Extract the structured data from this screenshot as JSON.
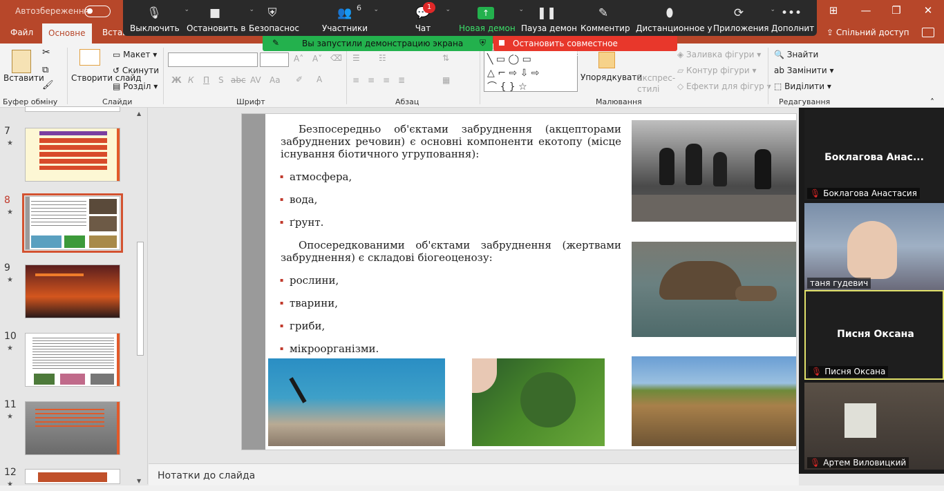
{
  "titlebar": {
    "autosave_label": "Автозбереження",
    "window_controls": [
      "⊞",
      "—",
      "❐",
      "✕"
    ]
  },
  "tabs": [
    "Файл",
    "Основне",
    "Вставл"
  ],
  "share_label": "Спільний доступ",
  "ribbon": {
    "paste_label": "Вставити",
    "new_slide_label": "Створити слайд",
    "layout_label": "Макет",
    "reset_label": "Скинути",
    "section_label": "Розділ",
    "group_clipboard": "Буфер обміну",
    "group_slides": "Слайди",
    "group_font": "Шрифт",
    "group_paragraph": "Абзац",
    "group_drawing": "Малювання",
    "group_editing": "Редагування",
    "arrange_label": "Упорядкувати",
    "quick_styles_label": "Експрес-стилі",
    "shape_fill": "Заливка фігури",
    "shape_outline": "Контур фігури",
    "shape_effects": "Ефекти для фігур",
    "find_label": "Знайти",
    "replace_label": "Замінити",
    "select_label": "Виділити",
    "font_buttons": [
      "Ж",
      "К",
      "П",
      "S",
      "abc",
      "AV",
      "Aa"
    ]
  },
  "zoom": {
    "buttons": [
      {
        "label": "Выключить",
        "icon": "microphone-icon",
        "glyph": "🎙"
      },
      {
        "label": "Остановить в",
        "icon": "video-camera-icon",
        "glyph": "■"
      },
      {
        "label": "Безопаснос",
        "icon": "shield-icon",
        "glyph": "⛨"
      },
      {
        "label": "Участники",
        "icon": "participants-icon",
        "glyph": "👥"
      },
      {
        "label": "Чат",
        "icon": "chat-icon",
        "glyph": "💬"
      },
      {
        "label": "Новая демон",
        "icon": "share-screen-icon",
        "glyph": "↑"
      },
      {
        "label": "Пауза демон",
        "icon": "pause-icon",
        "glyph": "❚❚"
      },
      {
        "label": "Комментир",
        "icon": "annotate-icon",
        "glyph": "✎"
      },
      {
        "label": "Дистанционное у",
        "icon": "remote-control-icon",
        "glyph": "⬮"
      },
      {
        "label": "Приложения",
        "icon": "apps-icon",
        "glyph": "⟳"
      },
      {
        "label": "Дополнит",
        "icon": "more-icon",
        "glyph": "•••"
      }
    ],
    "participant_count": "6",
    "chat_badge": "1",
    "share_banner": "Вы запустили демонстрацию экрана",
    "stop_banner": "Остановить совместное использование"
  },
  "thumbnails": [
    {
      "num": "7",
      "star": "★"
    },
    {
      "num": "8",
      "star": "★"
    },
    {
      "num": "9",
      "star": "★"
    },
    {
      "num": "10",
      "star": "★"
    },
    {
      "num": "11",
      "star": "★"
    },
    {
      "num": "12",
      "star": "★"
    }
  ],
  "slide": {
    "paragraph1": "Безпосередньо об'єктами забруднення (акцепторами забруднених речовин) є основні компоненти екотопу (місце існування біотичного угруповання):",
    "bullets1": [
      "атмосфера,",
      "вода,",
      "ґрунт."
    ],
    "paragraph2": "Опосередкованими об'єктами забруднення (жертвами забруднення) є складові біогеоценозу:",
    "bullets2": [
      "рослини,",
      "тварини,",
      "гриби,",
      "мікроорганізми."
    ]
  },
  "notes_placeholder": "Нотатки до слайда",
  "video_tiles": [
    {
      "big_name": "Боклагова  Анас...",
      "label": "Боклагова Анастасия",
      "muted": true
    },
    {
      "big_name": "",
      "label": "таня гудевич",
      "muted": false
    },
    {
      "big_name": "Писня Оксана",
      "label": "Писня Оксана",
      "muted": true
    },
    {
      "big_name": "",
      "label": "Артем Виловицкий",
      "muted": true
    }
  ]
}
